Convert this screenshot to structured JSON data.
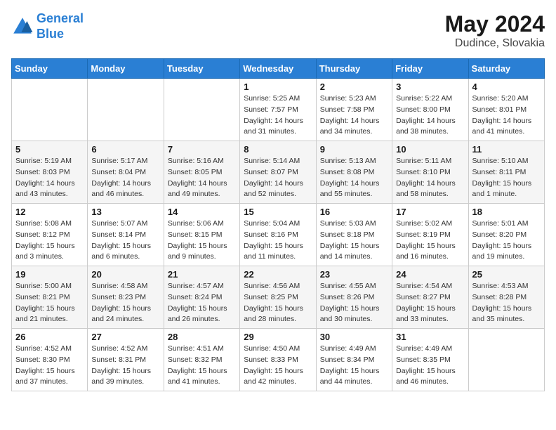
{
  "header": {
    "logo_line1": "General",
    "logo_line2": "Blue",
    "month_year": "May 2024",
    "location": "Dudince, Slovakia"
  },
  "days_of_week": [
    "Sunday",
    "Monday",
    "Tuesday",
    "Wednesday",
    "Thursday",
    "Friday",
    "Saturday"
  ],
  "weeks": [
    [
      {
        "day": "",
        "info": ""
      },
      {
        "day": "",
        "info": ""
      },
      {
        "day": "",
        "info": ""
      },
      {
        "day": "1",
        "info": "Sunrise: 5:25 AM\nSunset: 7:57 PM\nDaylight: 14 hours\nand 31 minutes."
      },
      {
        "day": "2",
        "info": "Sunrise: 5:23 AM\nSunset: 7:58 PM\nDaylight: 14 hours\nand 34 minutes."
      },
      {
        "day": "3",
        "info": "Sunrise: 5:22 AM\nSunset: 8:00 PM\nDaylight: 14 hours\nand 38 minutes."
      },
      {
        "day": "4",
        "info": "Sunrise: 5:20 AM\nSunset: 8:01 PM\nDaylight: 14 hours\nand 41 minutes."
      }
    ],
    [
      {
        "day": "5",
        "info": "Sunrise: 5:19 AM\nSunset: 8:03 PM\nDaylight: 14 hours\nand 43 minutes."
      },
      {
        "day": "6",
        "info": "Sunrise: 5:17 AM\nSunset: 8:04 PM\nDaylight: 14 hours\nand 46 minutes."
      },
      {
        "day": "7",
        "info": "Sunrise: 5:16 AM\nSunset: 8:05 PM\nDaylight: 14 hours\nand 49 minutes."
      },
      {
        "day": "8",
        "info": "Sunrise: 5:14 AM\nSunset: 8:07 PM\nDaylight: 14 hours\nand 52 minutes."
      },
      {
        "day": "9",
        "info": "Sunrise: 5:13 AM\nSunset: 8:08 PM\nDaylight: 14 hours\nand 55 minutes."
      },
      {
        "day": "10",
        "info": "Sunrise: 5:11 AM\nSunset: 8:10 PM\nDaylight: 14 hours\nand 58 minutes."
      },
      {
        "day": "11",
        "info": "Sunrise: 5:10 AM\nSunset: 8:11 PM\nDaylight: 15 hours\nand 1 minute."
      }
    ],
    [
      {
        "day": "12",
        "info": "Sunrise: 5:08 AM\nSunset: 8:12 PM\nDaylight: 15 hours\nand 3 minutes."
      },
      {
        "day": "13",
        "info": "Sunrise: 5:07 AM\nSunset: 8:14 PM\nDaylight: 15 hours\nand 6 minutes."
      },
      {
        "day": "14",
        "info": "Sunrise: 5:06 AM\nSunset: 8:15 PM\nDaylight: 15 hours\nand 9 minutes."
      },
      {
        "day": "15",
        "info": "Sunrise: 5:04 AM\nSunset: 8:16 PM\nDaylight: 15 hours\nand 11 minutes."
      },
      {
        "day": "16",
        "info": "Sunrise: 5:03 AM\nSunset: 8:18 PM\nDaylight: 15 hours\nand 14 minutes."
      },
      {
        "day": "17",
        "info": "Sunrise: 5:02 AM\nSunset: 8:19 PM\nDaylight: 15 hours\nand 16 minutes."
      },
      {
        "day": "18",
        "info": "Sunrise: 5:01 AM\nSunset: 8:20 PM\nDaylight: 15 hours\nand 19 minutes."
      }
    ],
    [
      {
        "day": "19",
        "info": "Sunrise: 5:00 AM\nSunset: 8:21 PM\nDaylight: 15 hours\nand 21 minutes."
      },
      {
        "day": "20",
        "info": "Sunrise: 4:58 AM\nSunset: 8:23 PM\nDaylight: 15 hours\nand 24 minutes."
      },
      {
        "day": "21",
        "info": "Sunrise: 4:57 AM\nSunset: 8:24 PM\nDaylight: 15 hours\nand 26 minutes."
      },
      {
        "day": "22",
        "info": "Sunrise: 4:56 AM\nSunset: 8:25 PM\nDaylight: 15 hours\nand 28 minutes."
      },
      {
        "day": "23",
        "info": "Sunrise: 4:55 AM\nSunset: 8:26 PM\nDaylight: 15 hours\nand 30 minutes."
      },
      {
        "day": "24",
        "info": "Sunrise: 4:54 AM\nSunset: 8:27 PM\nDaylight: 15 hours\nand 33 minutes."
      },
      {
        "day": "25",
        "info": "Sunrise: 4:53 AM\nSunset: 8:28 PM\nDaylight: 15 hours\nand 35 minutes."
      }
    ],
    [
      {
        "day": "26",
        "info": "Sunrise: 4:52 AM\nSunset: 8:30 PM\nDaylight: 15 hours\nand 37 minutes."
      },
      {
        "day": "27",
        "info": "Sunrise: 4:52 AM\nSunset: 8:31 PM\nDaylight: 15 hours\nand 39 minutes."
      },
      {
        "day": "28",
        "info": "Sunrise: 4:51 AM\nSunset: 8:32 PM\nDaylight: 15 hours\nand 41 minutes."
      },
      {
        "day": "29",
        "info": "Sunrise: 4:50 AM\nSunset: 8:33 PM\nDaylight: 15 hours\nand 42 minutes."
      },
      {
        "day": "30",
        "info": "Sunrise: 4:49 AM\nSunset: 8:34 PM\nDaylight: 15 hours\nand 44 minutes."
      },
      {
        "day": "31",
        "info": "Sunrise: 4:49 AM\nSunset: 8:35 PM\nDaylight: 15 hours\nand 46 minutes."
      },
      {
        "day": "",
        "info": ""
      }
    ]
  ]
}
